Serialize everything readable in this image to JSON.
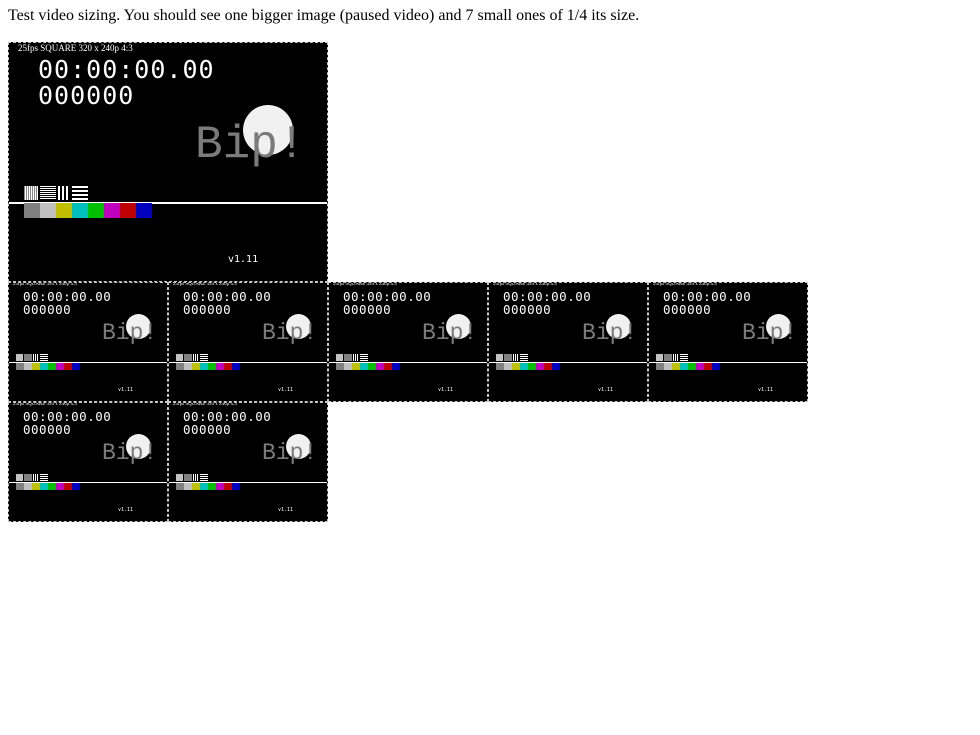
{
  "intro": "Test video sizing. You should see one bigger image (paused video) and 7 small ones of 1/4 its size.",
  "test_pattern": {
    "header": "25fps SQUARE 320 x 240p 4:3",
    "timecode": "00:00:00.00",
    "frame": "000000",
    "bip": "Bip!",
    "version": "v1.11",
    "bar_colors": [
      "#bfbfbf",
      "#bfbf00",
      "#00bfbf",
      "#00bf00",
      "#bf00bf",
      "#bf0000",
      "#0000bf"
    ],
    "gray_swatch": "#808080"
  },
  "videos": {
    "big": {
      "state": "paused"
    },
    "small_count": 7
  }
}
